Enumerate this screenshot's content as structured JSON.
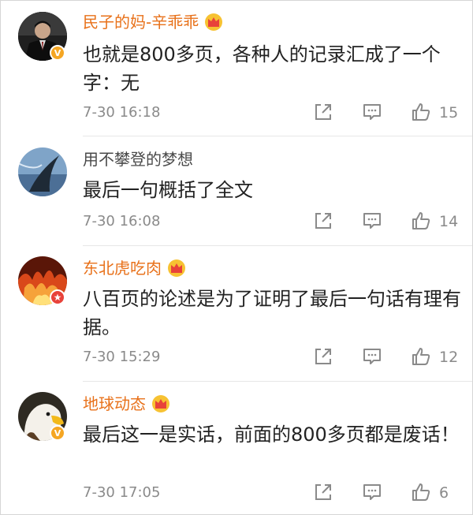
{
  "comments": [
    {
      "user": "民子的妈-辛乖乖",
      "vip": true,
      "badge": "V",
      "text": "也就是800多页，各种人的记录汇成了一个字：无",
      "time": "7-30 16:18",
      "likes": "15",
      "avatar": "person-in-suit-avatar"
    },
    {
      "user": "用不攀登的梦想",
      "vip": false,
      "badge": "",
      "text": "最后一句概括了全文",
      "time": "7-30 16:08",
      "likes": "14",
      "avatar": "shark-fin-avatar"
    },
    {
      "user": "东北虎吃肉",
      "vip": true,
      "badge": "star",
      "text": "八百页的论述是为了证明了最后一句话有理有据。",
      "time": "7-30 15:29",
      "likes": "12",
      "avatar": "fire-crowd-avatar"
    },
    {
      "user": "地球动态",
      "vip": true,
      "badge": "V",
      "text": "最后这一是实话，前面的800多页都是废话！",
      "time": "7-30 17:05",
      "likes": "6",
      "avatar": "eagle-avatar"
    }
  ],
  "icons": {
    "share": "share-icon",
    "reply": "comment-icon",
    "like": "thumbs-up-icon",
    "crown": "vip-crown-icon"
  },
  "colors": {
    "vip_name": "#e8711a",
    "plain_name": "#4a4a4a",
    "meta": "#8a8a8a",
    "badge_gold": "#f5a623",
    "badge_red": "#e8423a"
  }
}
